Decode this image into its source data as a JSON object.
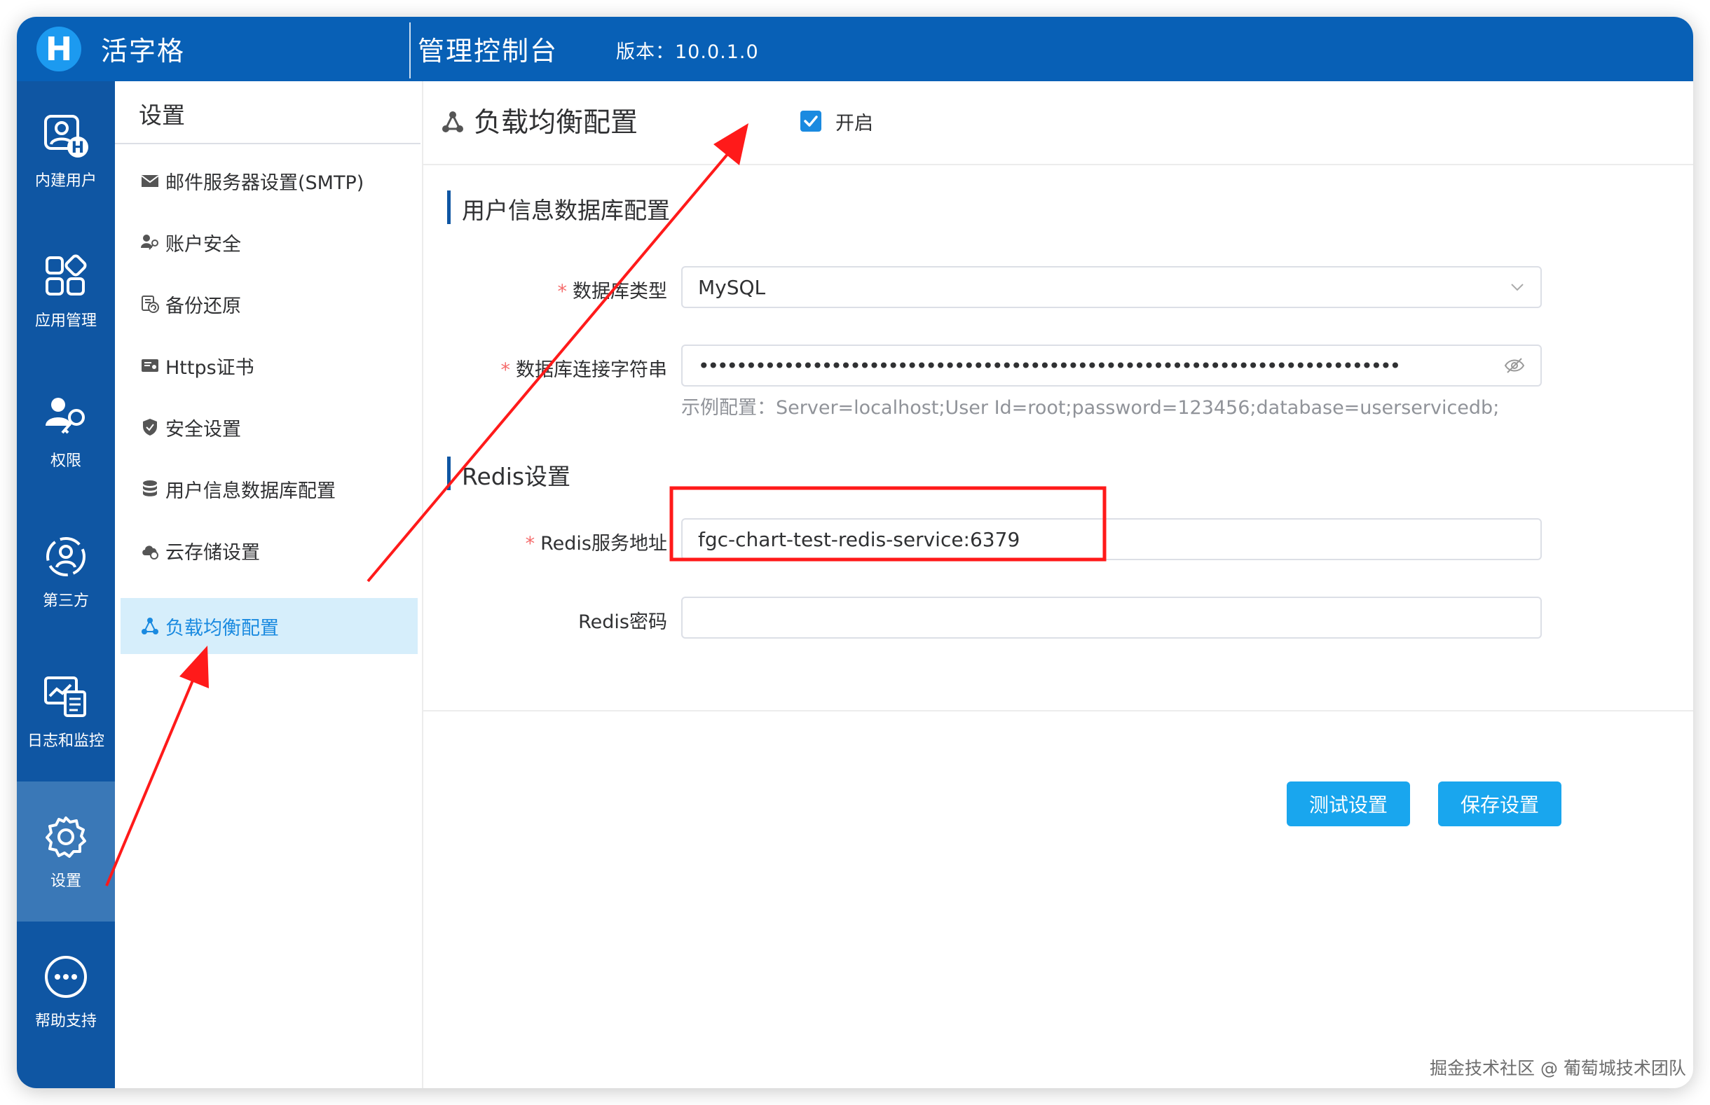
{
  "header": {
    "logo_letter": "H",
    "app_name": "活字格",
    "console_title": "管理控制台",
    "version": "版本：10.0.1.0"
  },
  "rail": {
    "items": [
      {
        "label": "内建用户",
        "icon": "builtin-user-icon"
      },
      {
        "label": "应用管理",
        "icon": "app-grid-icon"
      },
      {
        "label": "权限",
        "icon": "permission-key-icon"
      },
      {
        "label": "第三方",
        "icon": "third-party-icon"
      },
      {
        "label": "日志和监控",
        "icon": "log-monitor-icon"
      },
      {
        "label": "设置",
        "icon": "gear-icon",
        "active": true
      },
      {
        "label": "帮助支持",
        "icon": "help-more-icon"
      }
    ]
  },
  "sidebar": {
    "title": "设置",
    "items": [
      {
        "label": "邮件服务器设置(SMTP)",
        "icon": "mail-icon"
      },
      {
        "label": "账户安全",
        "icon": "account-key-icon"
      },
      {
        "label": "备份还原",
        "icon": "backup-icon"
      },
      {
        "label": "Https证书",
        "icon": "certificate-icon"
      },
      {
        "label": "安全设置",
        "icon": "shield-icon"
      },
      {
        "label": "用户信息数据库配置",
        "icon": "database-icon"
      },
      {
        "label": "云存储设置",
        "icon": "cloud-icon"
      },
      {
        "label": "负载均衡配置",
        "icon": "load-balance-icon",
        "active": true
      }
    ]
  },
  "main": {
    "title": "负载均衡配置",
    "enable_label": "开启",
    "enabled": true,
    "section_db": "用户信息数据库配置",
    "db_type_label": "数据库类型",
    "db_type_value": "MySQL",
    "conn_label": "数据库连接字符串",
    "conn_value": "••••••••••••••••••••••••••••••••••••••••••••••••••••••••••••••••••••••••••",
    "conn_hint": "示例配置：Server=localhost;User Id=root;password=123456;database=userservicedb;",
    "section_redis": "Redis设置",
    "redis_addr_label": "Redis服务地址",
    "redis_addr_value": "fgc-chart-test-redis-service:6379",
    "redis_pwd_label": "Redis密码",
    "redis_pwd_value": "",
    "test_button": "测试设置",
    "save_button": "保存设置"
  },
  "watermark": "掘金技术社区 @ 葡萄城技术团队",
  "colors": {
    "header": "#0860b6",
    "rail": "#0f56a3",
    "rail_active": "#3a78b7",
    "accent": "#19a6ee",
    "menu_active_bg": "#d6eefb",
    "annotation": "#ff1a1a"
  }
}
